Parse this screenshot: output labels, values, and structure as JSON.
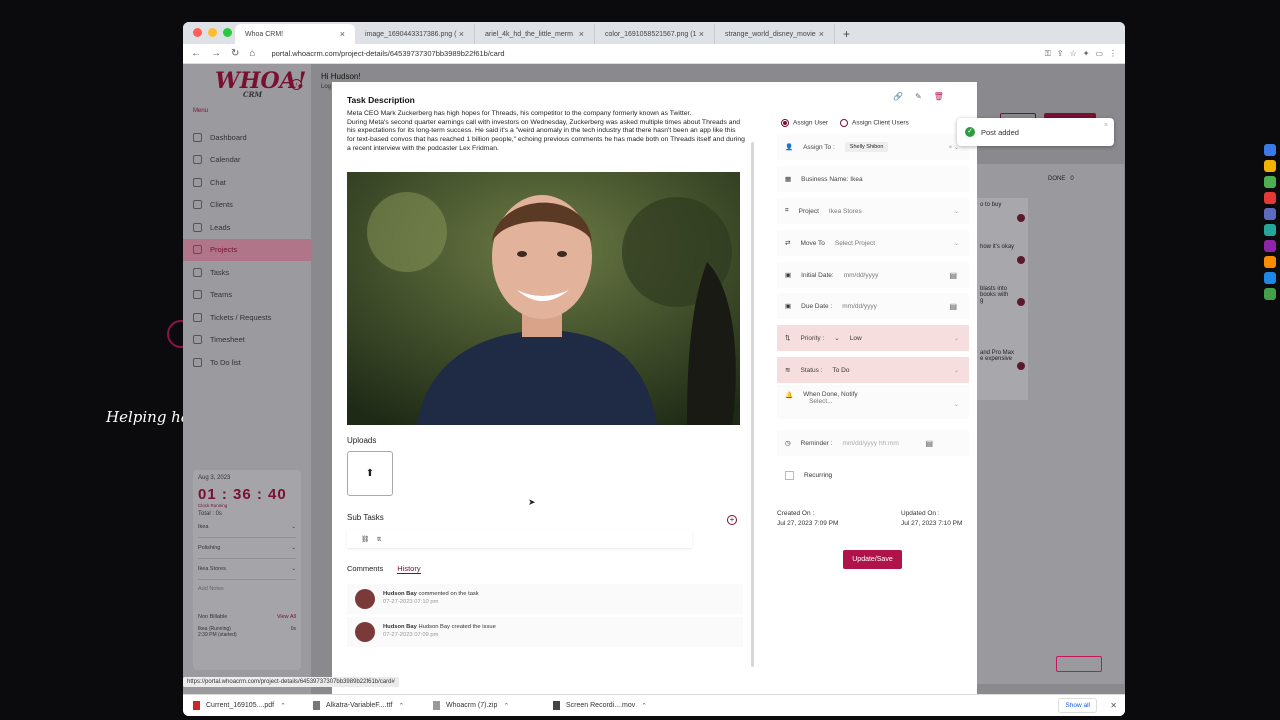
{
  "background": {
    "tagline": "Helping ha"
  },
  "browser": {
    "tabs": [
      {
        "title": "Whoa CRM!",
        "active": true
      },
      {
        "title": "image_1690443317386.png (",
        "active": false
      },
      {
        "title": "ariel_4k_hd_the_little_merm",
        "active": false
      },
      {
        "title": "color_1691058521567.png (1",
        "active": false
      },
      {
        "title": "strange_world_disney_movie",
        "active": false
      }
    ],
    "new_tab": "+",
    "url": "portal.whoacrm.com/project-details/64539737307bb3989b22f61b/card",
    "status_url": "https://portal.whoacrm.com/project-details/64539737307bb3989b22f61b/card#"
  },
  "app": {
    "logo": "WHOA!",
    "logo_sub": "CRM",
    "menu_label": "Menu",
    "greeting": "Hi Hudson!",
    "greeting_sub": "Log",
    "sidebar": [
      {
        "label": "Dashboard",
        "icon": "dashboard-icon"
      },
      {
        "label": "Calendar",
        "icon": "calendar-icon"
      },
      {
        "label": "Chat",
        "icon": "chat-icon"
      },
      {
        "label": "Clients",
        "icon": "clients-icon"
      },
      {
        "label": "Leads",
        "icon": "leads-icon"
      },
      {
        "label": "Projects",
        "icon": "projects-icon",
        "active": true
      },
      {
        "label": "Tasks",
        "icon": "tasks-icon"
      },
      {
        "label": "Teams",
        "icon": "teams-icon"
      },
      {
        "label": "Tickets / Requests",
        "icon": "tickets-icon"
      },
      {
        "label": "Timesheet",
        "icon": "timesheet-icon"
      },
      {
        "label": "To Do list",
        "icon": "todo-icon"
      }
    ],
    "timer": {
      "date": "Aug 3, 2023",
      "time": "01 : 36 : 40",
      "state": "Clock Running",
      "total": "Total : 0s",
      "rows": [
        "Ikea",
        "Polishing",
        "Ikea Stores"
      ],
      "notes_placeholder": "Add Notes",
      "non_billable": "Non Billable",
      "view_all": "View All",
      "entry_name": "Ikea",
      "entry_state": "(Running)",
      "entry_time": "2:39 PM",
      "entry_started": "(started)",
      "entry_total": "0s"
    },
    "board": {
      "back": "Back",
      "add_task": "+ Add Task",
      "column": "DONE",
      "column_count": "0",
      "cards": [
        "o to buy",
        "how it's okay",
        "blasts into\nbooks with\ng",
        "and Pro Max\ne expensive"
      ]
    },
    "toast": {
      "text": "Post added"
    }
  },
  "task": {
    "desc_title": "Task Description",
    "description": "Meta CEO Mark Zuckerberg has high hopes for Threads, his competitor to the company formerly known as Twitter.\nDuring Meta's second quarter earnings call with investors on Wednesday, Zuckerberg was asked multiple times about Threads and his expectations for its long-term success. He said it's a \"weird anomaly in the tech industry that there hasn't been an app like this for text-based convos that has reached 1 billion people,\" echoing previous comments he has made both on Threads itself and during a recent interview with the podcaster Lex Fridman.",
    "uploads_title": "Uploads",
    "subtasks_title": "Sub Tasks",
    "subtask": "tt",
    "tab_comments": "Comments",
    "tab_history": "History",
    "history": [
      {
        "user": "Hudson Bay",
        "action": "commented on the task",
        "date": "07-27-2023 07:10 pm"
      },
      {
        "user": "Hudson Bay",
        "action": "Hudson Bay created the issue",
        "date": "07-27-2023 07:09 pm"
      }
    ]
  },
  "form": {
    "assign_user": "Assign User",
    "assign_client": "Assign Client Users",
    "assign_to_label": "Assign To :",
    "assignee": "Shelly Shibon",
    "business_name": "Business Name: Ikea",
    "project_label": "Project",
    "project_value": "Ikea Stores",
    "move_to_label": "Move To",
    "move_to_value": "Select Project",
    "initial_date_label": "Initial Date:",
    "due_date_label": "Due Date :",
    "date_placeholder": "mm/dd/yyyy",
    "priority_label": "Priority :",
    "priority_value": "Low",
    "status_label": "Status :",
    "status_value": "To Do",
    "notify_label": "When Done, Notify",
    "notify_value": "Select...",
    "reminder_label": "Reminder :",
    "reminder_placeholder": "mm/dd/yyyy hh:mm",
    "recurring_label": "Recurring",
    "created_label": "Created On :",
    "created_value": "Jul 27, 2023 7:09 PM",
    "updated_label": "Updated On :",
    "updated_value": "Jul 27, 2023 7:10 PM",
    "save": "Update/Save"
  },
  "downloads": {
    "items": [
      "Current_169105....pdf",
      "Alkatra-VariableF....ttf",
      "Whoacrm (7).zip",
      "Screen Recordi....mov"
    ],
    "show_all": "Show all"
  },
  "colors": {
    "accent": "#7a1030",
    "save": "#b0134a",
    "ok": "#2e9d42"
  }
}
